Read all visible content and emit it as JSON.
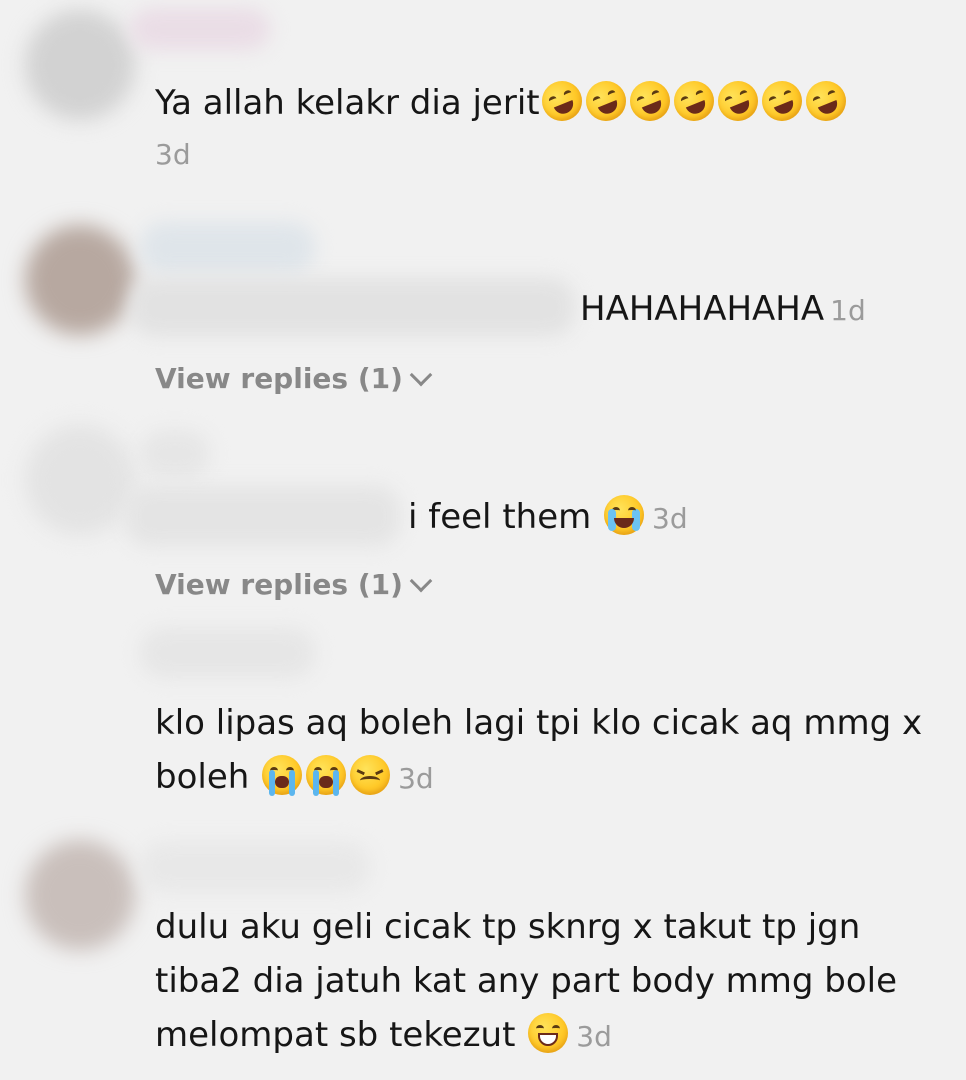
{
  "comments": [
    {
      "text": "Ya allah kelakr dia jerit",
      "emoji": [
        "rofl",
        "rofl",
        "rofl",
        "rofl",
        "rofl",
        "rofl",
        "rofl"
      ],
      "time": "3d"
    },
    {
      "text": "HAHAHAHAHA",
      "time": "1d",
      "view_replies": "View replies (1)"
    },
    {
      "text": "i feel them",
      "emoji": [
        "tears-of-joy"
      ],
      "time": "3d",
      "view_replies": "View replies (1)"
    },
    {
      "text_line1": "klo lipas aq boleh lagi tpi klo cicak aq mmg x",
      "text_line2": "boleh",
      "emoji": [
        "loudly-crying",
        "loudly-crying",
        "confounded"
      ],
      "time": "3d"
    },
    {
      "text_line1": "dulu aku geli cicak tp sknrg x takut tp jgn",
      "text_line2": "tiba2 dia jatuh kat any part body mmg bole",
      "text_line3": "melompat sb tekezut",
      "emoji": [
        "grinning"
      ],
      "time": "3d"
    }
  ]
}
